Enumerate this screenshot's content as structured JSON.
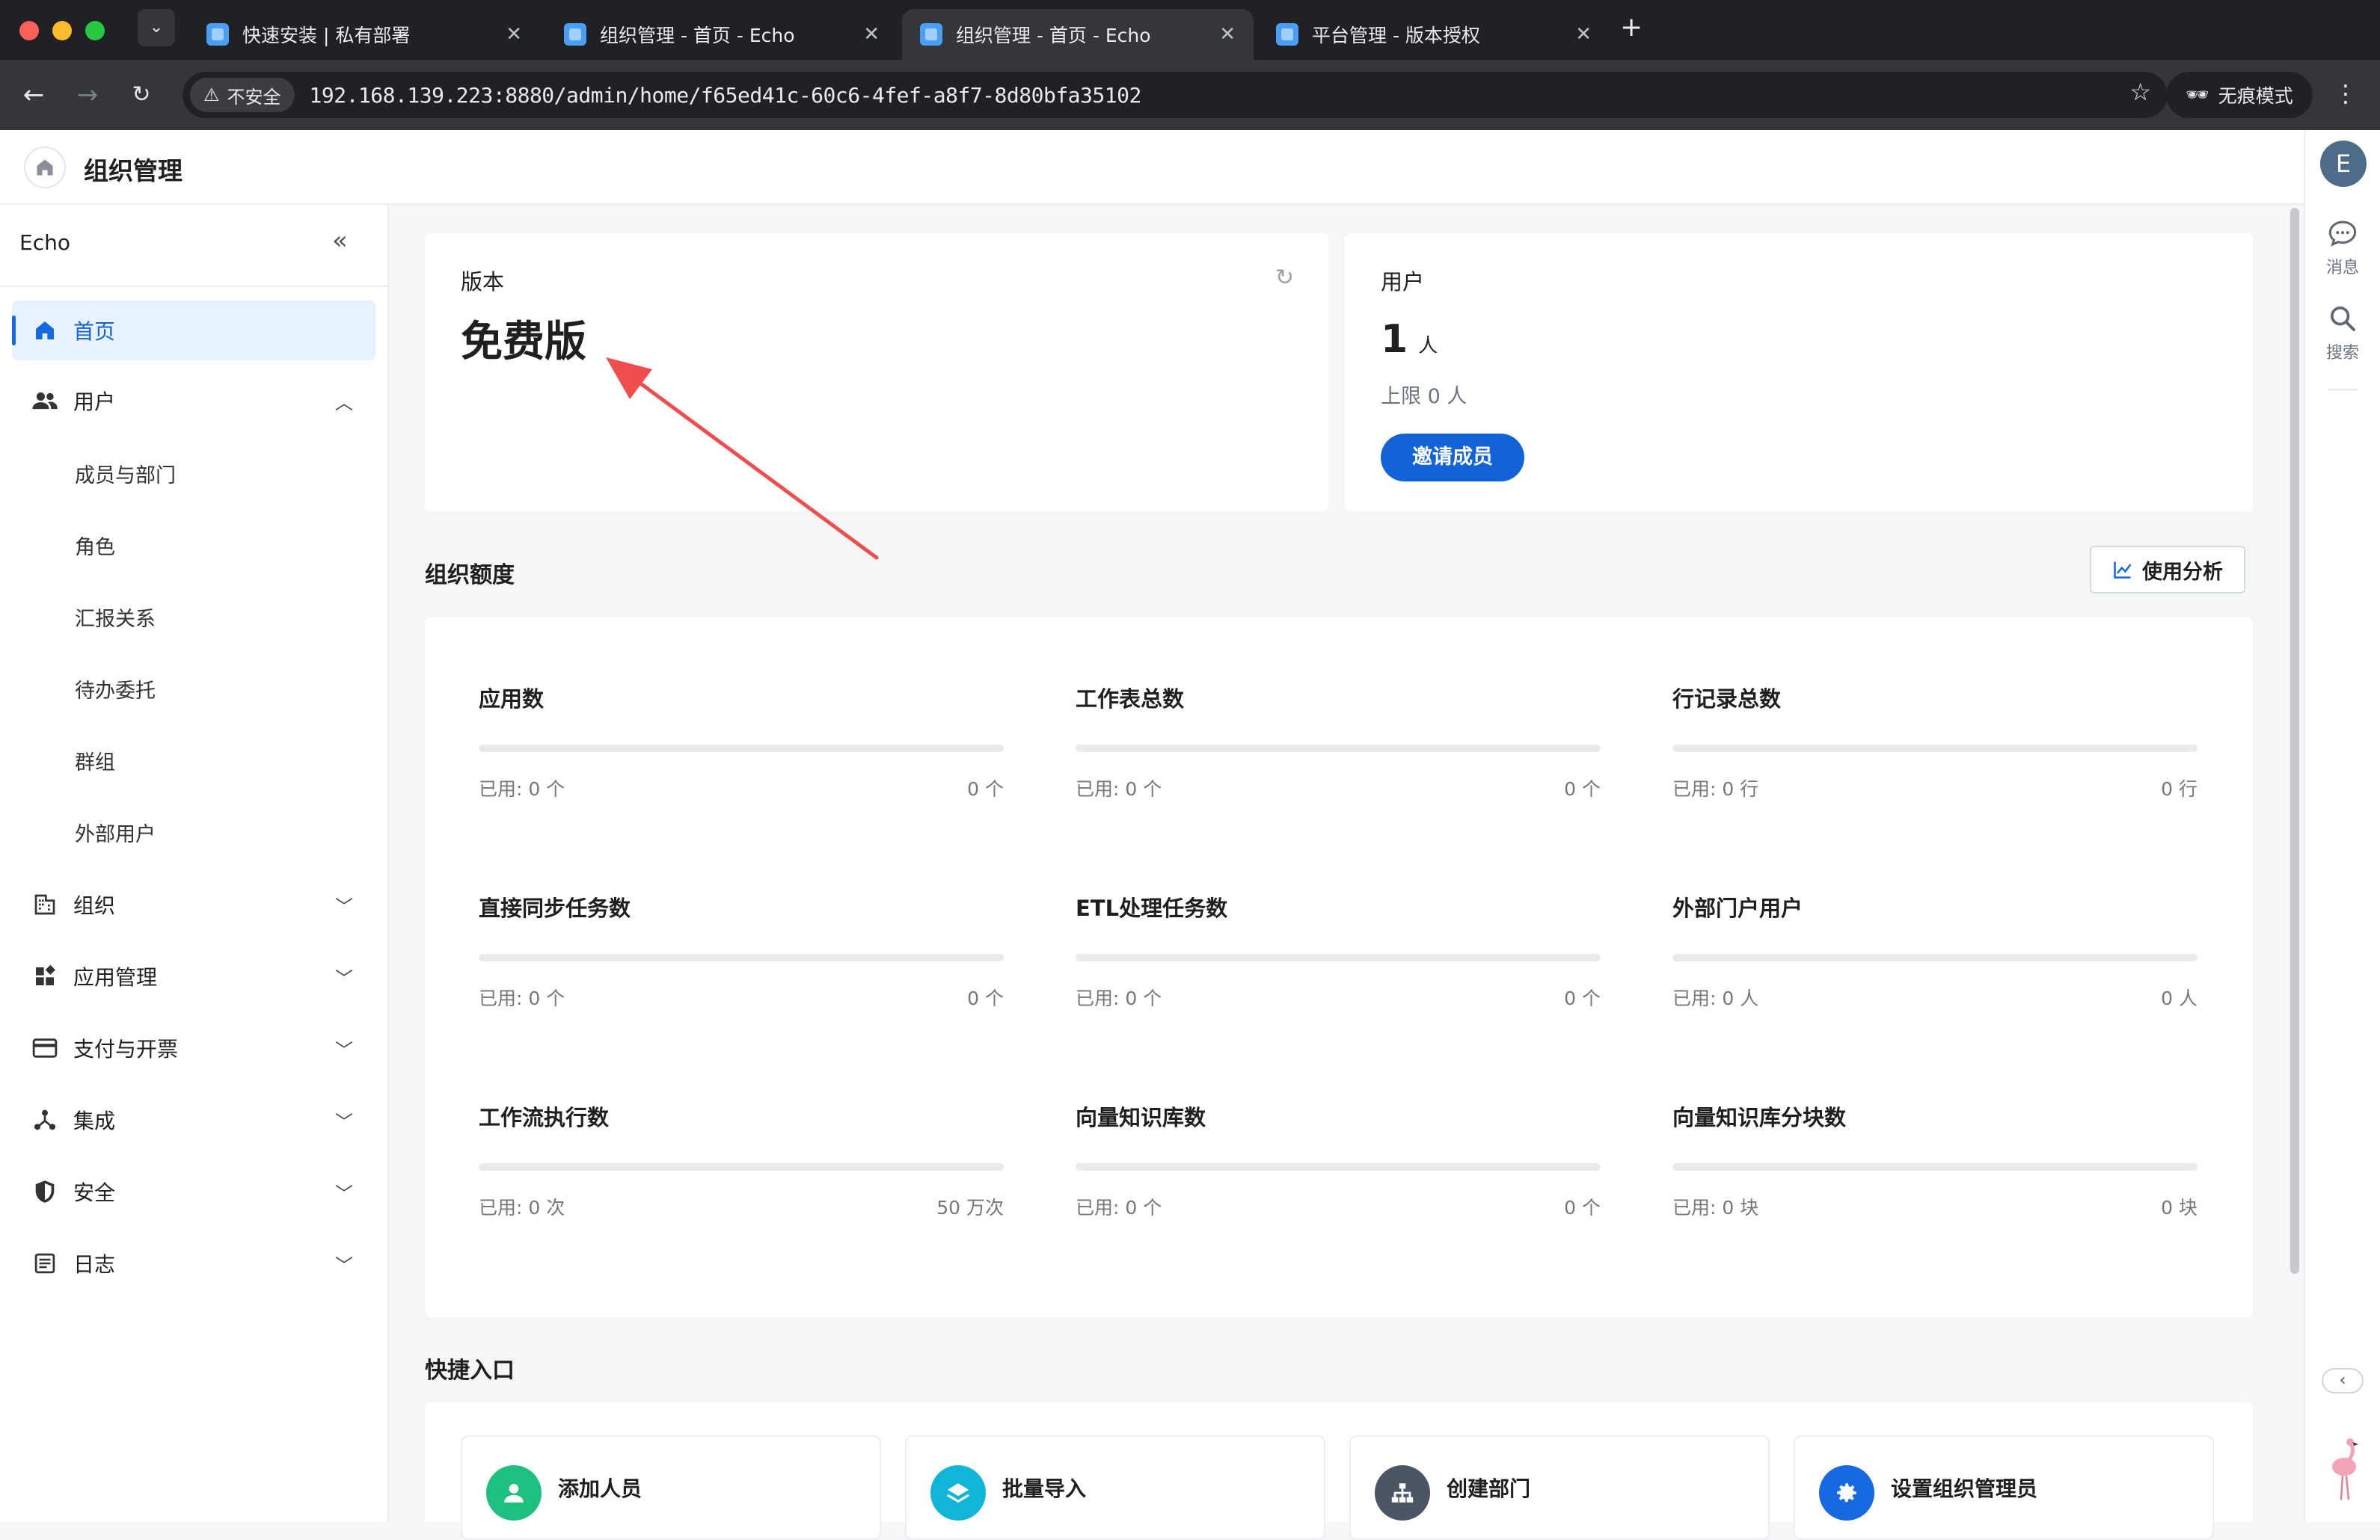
{
  "browser": {
    "tabs": [
      {
        "title": "快速安装 | 私有部署",
        "active": false
      },
      {
        "title": "组织管理 - 首页 - Echo",
        "active": false
      },
      {
        "title": "组织管理 - 首页 - Echo",
        "active": true
      },
      {
        "title": "平台管理 - 版本授权",
        "active": false
      }
    ],
    "insecure_label": "不安全",
    "url": "192.168.139.223:8880/admin/home/f65ed41c-60c6-4fef-a8f7-8d80bfa35102",
    "incognito_label": "无痕模式"
  },
  "header": {
    "title": "组织管理"
  },
  "rail": {
    "avatar_letter": "E",
    "messages_label": "消息",
    "search_label": "搜索"
  },
  "sidebar": {
    "org_name": "Echo",
    "items": [
      {
        "label": "首页",
        "icon": "home-icon",
        "active": true
      },
      {
        "label": "用户",
        "icon": "users-icon",
        "expanded": true
      },
      {
        "label": "组织",
        "icon": "building-icon"
      },
      {
        "label": "应用管理",
        "icon": "apps-icon"
      },
      {
        "label": "支付与开票",
        "icon": "card-icon"
      },
      {
        "label": "集成",
        "icon": "integration-icon"
      },
      {
        "label": "安全",
        "icon": "shield-icon"
      },
      {
        "label": "日志",
        "icon": "log-icon"
      }
    ],
    "user_subitems": [
      "成员与部门",
      "角色",
      "汇报关系",
      "待办委托",
      "群组",
      "外部用户"
    ]
  },
  "version_card": {
    "label": "版本",
    "value": "免费版"
  },
  "users_card": {
    "label": "用户",
    "count": "1",
    "unit": "人",
    "limit": "上限 0 人",
    "invite_label": "邀请成员"
  },
  "quota": {
    "title": "组织额度",
    "analysis_label": "使用分析",
    "items": [
      {
        "title": "应用数",
        "used": "已用: 0 个",
        "limit": "0 个",
        "fill": 0
      },
      {
        "title": "工作表总数",
        "used": "已用: 0 个",
        "limit": "0 个",
        "fill": 0
      },
      {
        "title": "行记录总数",
        "used": "已用: 0 行",
        "limit": "0 行",
        "fill": 0
      },
      {
        "title": "直接同步任务数",
        "used": "已用: 0 个",
        "limit": "0 个",
        "fill": 0
      },
      {
        "title": "ETL处理任务数",
        "used": "已用: 0 个",
        "limit": "0 个",
        "fill": 0
      },
      {
        "title": "外部门户用户",
        "used": "已用: 0 人",
        "limit": "0 人",
        "fill": 0
      },
      {
        "title": "工作流执行数",
        "used": "已用: 0 次",
        "limit": "50 万次",
        "fill": 0
      },
      {
        "title": "向量知识库数",
        "used": "已用: 0 个",
        "limit": "0 个",
        "fill": 0
      },
      {
        "title": "向量知识库分块数",
        "used": "已用: 0 块",
        "limit": "0 块",
        "fill": 0
      }
    ]
  },
  "shortcuts": {
    "title": "快捷入口",
    "items": [
      {
        "label": "添加人员",
        "color": "#1dc07e"
      },
      {
        "label": "批量导入",
        "color": "#11b5d8"
      },
      {
        "label": "创建部门",
        "color": "#4b5563"
      },
      {
        "label": "设置组织管理员",
        "color": "#1668e3"
      }
    ]
  },
  "colors": {
    "primary": "#1262d8",
    "active_bg": "#e8f1fe",
    "annotation_arrow": "#ef4e4e"
  }
}
